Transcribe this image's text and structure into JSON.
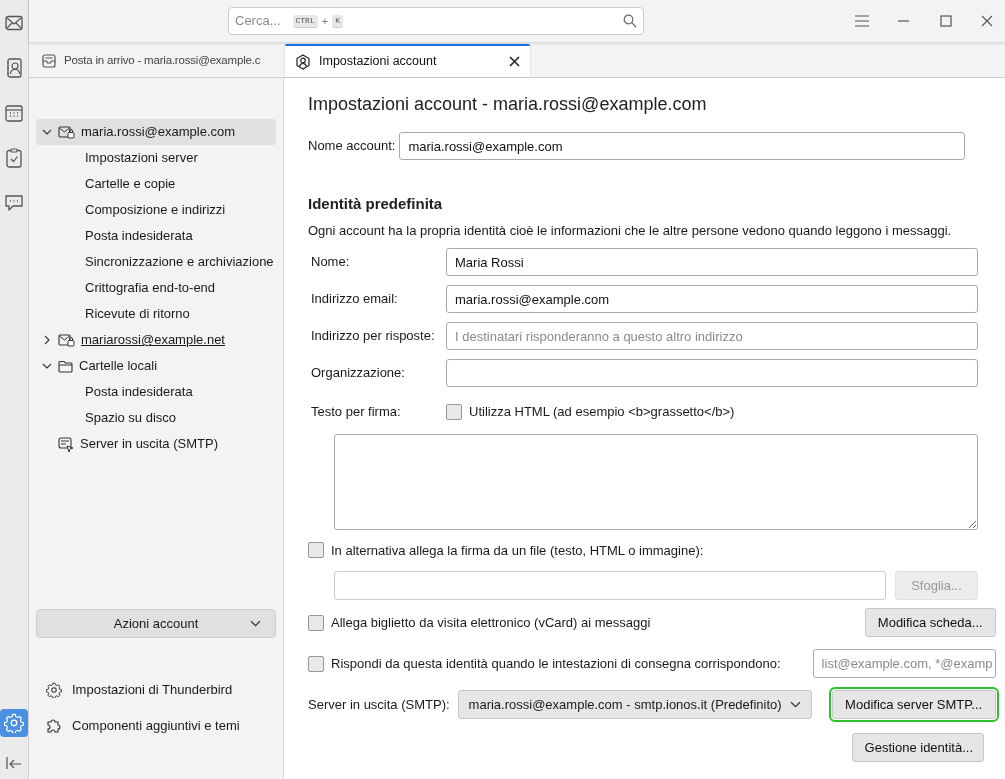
{
  "spaces": [
    {
      "kind": "mail",
      "selected": false
    },
    {
      "kind": "contacts",
      "selected": false
    },
    {
      "kind": "calendar",
      "selected": false
    },
    {
      "kind": "tasks",
      "selected": false
    },
    {
      "kind": "chat",
      "selected": false
    }
  ],
  "spaces_bottom": [
    {
      "kind": "settings",
      "selected": true
    },
    {
      "kind": "collapse",
      "selected": false
    }
  ],
  "search": {
    "placeholder": "Cerca...",
    "shortcut_keys": [
      "CTRL",
      "K"
    ],
    "shortcut_joiner": "+"
  },
  "tabs": [
    {
      "kind": "inbox",
      "label": "Posta in arrivo - maria.rossi@example.c",
      "selected": false
    },
    {
      "kind": "account",
      "label": "Impostazioni account",
      "selected": true
    }
  ],
  "account_tree": [
    {
      "kind": "account",
      "label": "maria.rossi@example.com",
      "expanded": true,
      "selected": true,
      "hovered": false,
      "children": [
        {
          "label": "Impostazioni server"
        },
        {
          "label": "Cartelle e copie"
        },
        {
          "label": "Composizione e indirizzi"
        },
        {
          "label": "Posta indesiderata"
        },
        {
          "label": "Sincronizzazione e archiviazione"
        },
        {
          "label": "Crittografia end-to-end"
        },
        {
          "label": "Ricevute di ritorno"
        }
      ]
    },
    {
      "kind": "account",
      "label": "mariarossi@example.net",
      "expanded": false,
      "selected": false,
      "hovered": true
    },
    {
      "kind": "folder",
      "label": "Cartelle locali",
      "expanded": true,
      "selected": false,
      "hovered": false,
      "children": [
        {
          "label": "Posta indesiderata"
        },
        {
          "label": "Spazio su disco"
        }
      ]
    },
    {
      "kind": "smtp",
      "label": "Server in uscita (SMTP)",
      "selected": false,
      "hovered": false
    }
  ],
  "account_actions": "Azioni account",
  "footer_links": [
    {
      "kind": "settings",
      "label": "Impostazioni di Thunderbird"
    },
    {
      "kind": "addons",
      "label": "Componenti aggiuntivi e temi"
    }
  ],
  "page_title": "Impostazioni account - maria.rossi@example.com",
  "account_name": {
    "label": "Nome account:",
    "value": "maria.rossi@example.com"
  },
  "identity": {
    "heading": "Identità predefinita",
    "description": "Ogni account ha la propria identità cioè le informazioni che le altre persone vedono quando leggono i messaggi.",
    "fields": [
      {
        "label": "Nome:",
        "value": "Maria Rossi"
      },
      {
        "label": "Indirizzo email:",
        "value": "maria.rossi@example.com"
      },
      {
        "label": "Indirizzo per risposte:",
        "placeholder": "I destinatari risponderanno a questo altro indirizzo"
      },
      {
        "label": "Organizzazione:"
      }
    ],
    "signature": {
      "label": "Testo per firma:",
      "html_option": {
        "label": "Utilizza HTML (ad esempio <b>grassetto</b>)",
        "checked": false
      }
    },
    "attach_file": {
      "label": "In alternativa allega la firma da un file (testo, HTML o immagine):",
      "checked": false,
      "button": {
        "label": "Sfoglia...",
        "disabled": true
      }
    },
    "vcard": {
      "label": "Allega biglietto da visita elettronico (vCard) ai messaggi",
      "checked": false,
      "button": {
        "label": "Modifica scheda...",
        "disabled": false
      }
    },
    "reply_from": {
      "label": "Rispondi da questa identità quando le intestazioni di consegna corrispondono:",
      "checked": false,
      "placeholder": "list@example.com, *@examp"
    },
    "smtp": {
      "label": "Server in uscita (SMTP):",
      "value": "maria.rossi@example.com - smtp.ionos.it (Predefinito)",
      "button": {
        "label": "Modifica server SMTP...",
        "focused": true
      }
    },
    "manage_button": "Gestione identità..."
  }
}
